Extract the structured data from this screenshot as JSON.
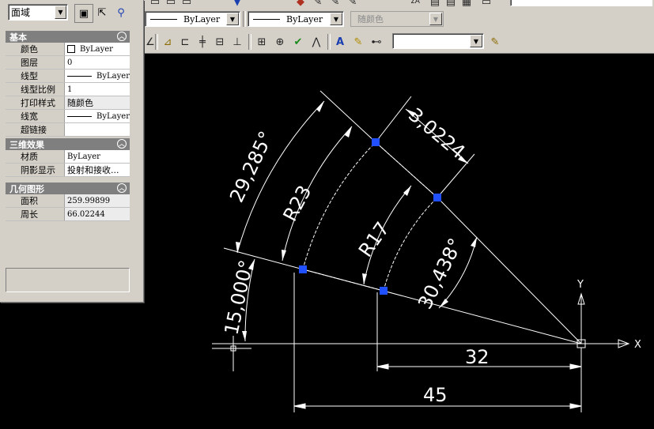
{
  "toolbar": {
    "color_combo": "ByLayer",
    "linetype_combo": "ByLayer",
    "lineweight_combo": "ByLayer",
    "plotstyle_combo": "随颜色",
    "dimstyle_combo": ""
  },
  "properties": {
    "object_type": "面域",
    "sections": [
      {
        "title": "基本",
        "rows": [
          {
            "label": "颜色",
            "value": "ByLayer"
          },
          {
            "label": "图层",
            "value": "0"
          },
          {
            "label": "线型",
            "value": "ByLayer"
          },
          {
            "label": "线型比例",
            "value": "1"
          },
          {
            "label": "打印样式",
            "value": "随颜色"
          },
          {
            "label": "线宽",
            "value": "ByLayer"
          },
          {
            "label": "超链接",
            "value": ""
          }
        ]
      },
      {
        "title": "三维效果",
        "rows": [
          {
            "label": "材质",
            "value": "ByLayer"
          },
          {
            "label": "阴影显示",
            "value": "投射和接收..."
          }
        ]
      },
      {
        "title": "几何图形",
        "rows": [
          {
            "label": "面积",
            "value": "259.99899"
          },
          {
            "label": "周长",
            "value": "66.02244"
          }
        ]
      }
    ]
  },
  "drawing": {
    "dims": {
      "d32": "32",
      "d45": "45",
      "a15": "15,000°",
      "a29": "29,285°",
      "a30": "30,438°",
      "d3": "3,0224",
      "r23": "R23",
      "r17": "R17"
    },
    "axis_x": "X",
    "axis_y": "Y"
  }
}
